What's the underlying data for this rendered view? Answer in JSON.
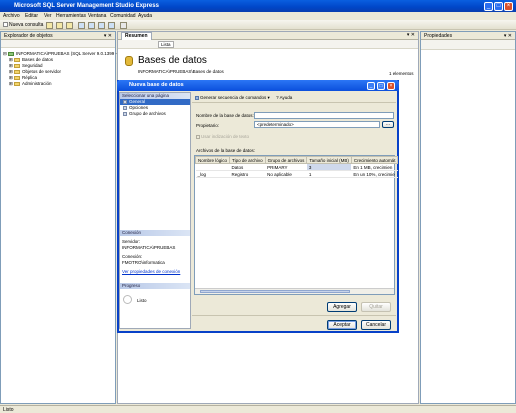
{
  "app": {
    "title": "Microsoft SQL Server Management Studio Express",
    "window_buttons": [
      "_",
      "□",
      "×"
    ]
  },
  "menu": [
    "Archivo",
    "Editar",
    "Ver",
    "Herramientas",
    "Ventana",
    "Comunidad",
    "Ayuda"
  ],
  "toolbar": {
    "new_query": "Nueva consulta"
  },
  "object_explorer": {
    "title": "Explorador de objetos",
    "tree": [
      {
        "label": "INFORMATICA\\PRUEBAS (SQL Server 9.0.1399 - ",
        "level": 0
      },
      {
        "label": "Bases de datos",
        "level": 1
      },
      {
        "label": "Seguridad",
        "level": 1
      },
      {
        "label": "Objetos de servidor",
        "level": 1
      },
      {
        "label": "Réplica",
        "level": 1
      },
      {
        "label": "Administración",
        "level": 1
      }
    ]
  },
  "summary": {
    "tab": "Resumen",
    "list_label": "Lista",
    "heading": "Bases de datos",
    "path": "INFORMATICA\\PRUEBAS\\Bases de datos",
    "count": "1 elementos"
  },
  "properties": {
    "title": "Propiedades"
  },
  "dialog": {
    "title": "Nueva base de datos",
    "select_page_header": "Seleccionar una página",
    "pages": [
      {
        "label": "General",
        "selected": true
      },
      {
        "label": "Opciones",
        "selected": false
      },
      {
        "label": "Grupo de archivos",
        "selected": false
      }
    ],
    "script_button": "Generar secuencia de comandos",
    "help_button": "Ayuda",
    "db_name_label": "Nombre de la base de datos:",
    "db_name_value": "",
    "owner_label": "Propietario:",
    "owner_value": "<predeterminado>",
    "browse_button": "...",
    "fulltext_label": "Usar indización de texto",
    "files_label": "Archivos de la base de datos:",
    "columns": [
      "Nombre lógico",
      "Tipo de archivo",
      "Grupo de archivos",
      "Tamaño inicial (MB)",
      "Crecimiento automát"
    ],
    "rows": [
      [
        "",
        "Datos",
        "PRIMARY",
        "3",
        "En 1 MB, crecimien"
      ],
      [
        "_log",
        "Registro",
        "No aplicable",
        "1",
        "En un 10%, crecimie"
      ]
    ],
    "connection_header": "Conexión",
    "server_label": "Servidor:",
    "server_value": "INFORMATICA\\PRUEBAS",
    "connection_label": "Conexión:",
    "connection_value": "FMOTRO\\informatica",
    "view_conn_props": "Ver propiedades de conexión",
    "progress_header": "Progreso",
    "progress_status": "Listo",
    "add_button": "Agregar",
    "remove_button": "Quitar",
    "ok_button": "Aceptar",
    "cancel_button": "Cancelar"
  },
  "status": {
    "text": "Listo"
  }
}
